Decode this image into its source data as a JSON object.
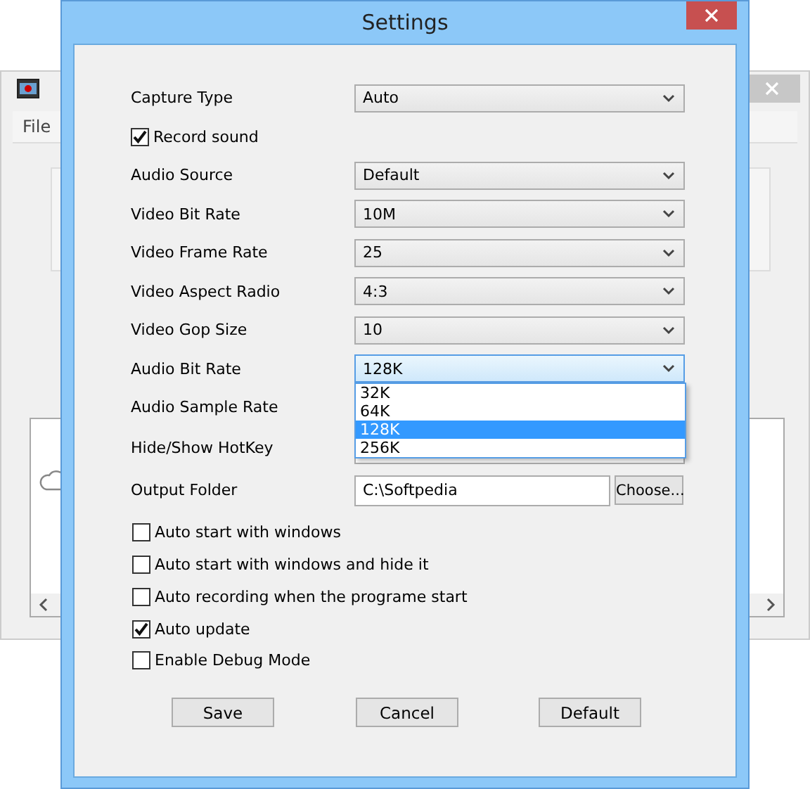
{
  "background_window": {
    "menu": [
      "File"
    ]
  },
  "window": {
    "title": "Settings"
  },
  "fields": [
    {
      "kind": "select",
      "label": "Capture Type",
      "value": "Auto"
    },
    {
      "kind": "checkbox",
      "label": "Record sound",
      "checked": true
    },
    {
      "kind": "select",
      "label": "Audio Source",
      "value": "Default"
    },
    {
      "kind": "select",
      "label": "Video Bit Rate",
      "value": "10M"
    },
    {
      "kind": "select",
      "label": "Video Frame Rate",
      "value": "25"
    },
    {
      "kind": "select",
      "label": "Video Aspect Radio",
      "value": "4:3"
    },
    {
      "kind": "select",
      "label": "Video Gop Size",
      "value": "10"
    },
    {
      "kind": "select",
      "label": "Audio Bit Rate",
      "value": "128K",
      "expanded": true,
      "options": [
        {
          "label": "32K",
          "selected": false
        },
        {
          "label": "64K",
          "selected": false
        },
        {
          "label": "128K",
          "selected": true
        },
        {
          "label": "256K",
          "selected": false
        }
      ]
    },
    {
      "kind": "select",
      "label": "Audio Sample Rate"
    },
    {
      "kind": "text",
      "label": "Hide/Show HotKey"
    },
    {
      "kind": "folder",
      "label": "Output Folder",
      "value": "C:\\Softpedia",
      "button": "Choose..."
    }
  ],
  "options": [
    {
      "label": "Auto start with windows",
      "checked": false
    },
    {
      "label": "Auto start with windows and hide it",
      "checked": false
    },
    {
      "label": "Auto recording when the programe start",
      "checked": false
    },
    {
      "label": "Auto update",
      "checked": true
    },
    {
      "label": "Enable Debug Mode",
      "checked": false
    }
  ],
  "buttons": [
    "Save",
    "Cancel",
    "Default"
  ]
}
